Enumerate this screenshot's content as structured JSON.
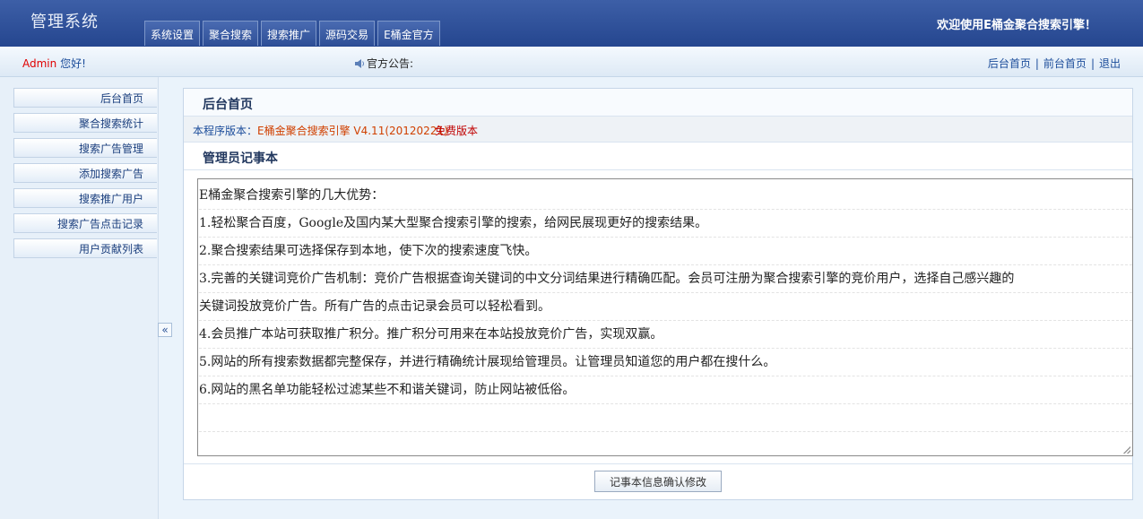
{
  "header": {
    "brand": "管理系统",
    "tabs": [
      {
        "label": "系统设置"
      },
      {
        "label": "聚合搜索"
      },
      {
        "label": "搜索推广"
      },
      {
        "label": "源码交易"
      },
      {
        "label": "E桶金官方"
      }
    ],
    "welcome": "欢迎使用E桶金聚合搜索引擎！"
  },
  "infobar": {
    "user_name": "Admin",
    "greeting": " 您好!",
    "notice_label": "官方公告:",
    "links": [
      {
        "label": "后台首页"
      },
      {
        "label": "前台首页"
      },
      {
        "label": "退出"
      }
    ],
    "separator": "|"
  },
  "sidebar": {
    "items": [
      {
        "label": "后台首页"
      },
      {
        "label": "聚合搜索统计"
      },
      {
        "label": "搜索广告管理"
      },
      {
        "label": "添加搜索广告"
      },
      {
        "label": "搜索推广用户"
      },
      {
        "label": "搜索广告点击记录"
      },
      {
        "label": "用户贡献列表"
      }
    ],
    "collapse_glyph": "«"
  },
  "main": {
    "title": "后台首页",
    "version_prefix": "本程序版本：",
    "version_value": "E桶金聚合搜索引擎 V4.11(20120221)",
    "version_suffix": " 免费版本",
    "notepad_title": "管理员记事本",
    "notepad_lines": [
      "E桶金聚合搜索引擎的几大优势：",
      "1.轻松聚合百度，Google及国内某大型聚合搜索引擎的搜索，给网民展现更好的搜索结果。",
      "2.聚合搜索结果可选择保存到本地，使下次的搜索速度飞快。",
      "3.完善的关键词竞价广告机制：竞价广告根据查询关键词的中文分词结果进行精确匹配。会员可注册为聚合搜索引擎的竞价用户，选择自己感兴趣的",
      "关键词投放竞价广告。所有广告的点击记录会员可以轻松看到。",
      "4.会员推广本站可获取推广积分。推广积分可用来在本站投放竞价广告，实现双赢。",
      "5.网站的所有搜索数据都完整保存，并进行精确统计展现给管理员。让管理员知道您的用户都在搜什么。",
      "6.网站的黑名单功能轻松过滤某些不和谐关键词，防止网站被低俗。",
      "",
      ""
    ],
    "confirm_label": "记事本信息确认修改"
  },
  "colors": {
    "header_bg": "#2f519a",
    "user_name": "#e00000",
    "link": "#1b4c9a",
    "version_value": "#c00000"
  }
}
